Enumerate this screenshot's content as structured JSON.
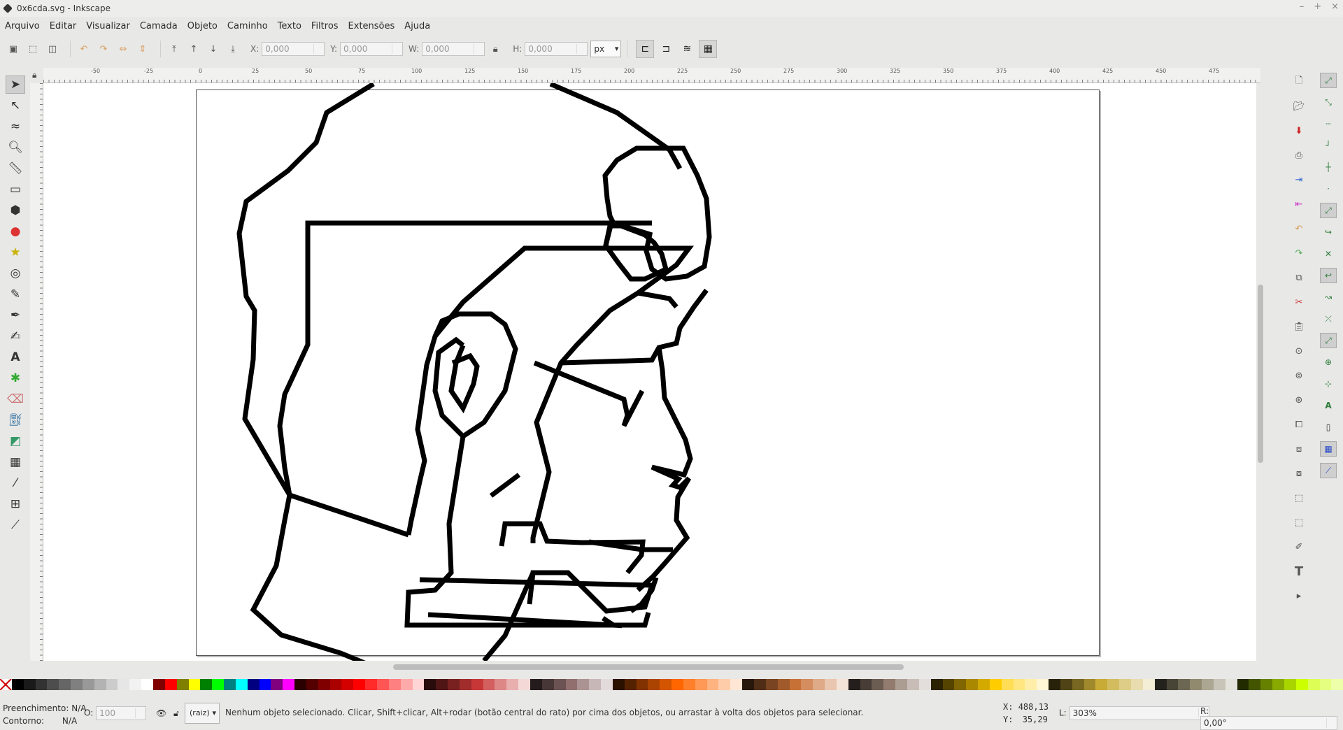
{
  "window": {
    "title": "0x6cda.svg - Inkscape",
    "controls": [
      "–",
      "+",
      "×"
    ]
  },
  "menu": [
    "Arquivo",
    "Editar",
    "Visualizar",
    "Camada",
    "Objeto",
    "Caminho",
    "Texto",
    "Filtros",
    "Extensões",
    "Ajuda"
  ],
  "toolbar": {
    "x_label": "X:",
    "x_value": "0,000",
    "y_label": "Y:",
    "y_value": "0,000",
    "w_label": "W:",
    "w_value": "0,000",
    "h_label": "H:",
    "h_value": "0,000",
    "unit": "px"
  },
  "ruler_ticks": [
    "-50",
    "-25",
    "0",
    "25",
    "50",
    "75",
    "100",
    "125",
    "150",
    "175",
    "200",
    "225",
    "250",
    "275",
    "300",
    "325",
    "350",
    "375",
    "400",
    "425",
    "450",
    "475"
  ],
  "tools": [
    "selector-tool",
    "node-tool",
    "tweak-tool",
    "zoom-tool",
    "measure-tool",
    "rectangle-tool",
    "3d-box-tool",
    "ellipse-tool",
    "star-tool",
    "spiral-tool",
    "pencil-tool",
    "pen-tool",
    "calligraphy-tool",
    "text-tool",
    "spray-tool",
    "eraser-tool",
    "paint-bucket-tool",
    "gradient-tool",
    "mesh-tool",
    "dropper-tool",
    "connector-tool",
    "lpe-tool"
  ],
  "status": {
    "fill_label": "Preenchimento:",
    "fill_value": "N/A",
    "stroke_label": "Contorno:",
    "stroke_value": "N/A",
    "opacity_label": "O:",
    "opacity_value": "100",
    "layer": "(raiz)",
    "message": "Nenhum objeto selecionado. Clicar, Shift+clicar, Alt+rodar (botão central do rato) por cima dos objetos, ou arrastar à volta dos objetos para selecionar.",
    "x_label": "X:",
    "x_value": "488,13",
    "y_label": "Y:",
    "y_value": "35,29",
    "zoom_label": "L:",
    "zoom_value": "303%",
    "rotation_label": "R:",
    "rotation_value": "0,00°"
  },
  "palette": [
    "#000000",
    "#1a1a1a",
    "#333333",
    "#4d4d4d",
    "#666666",
    "#808080",
    "#999999",
    "#b3b3b3",
    "#cccccc",
    "#e6e6e6",
    "#f2f2f2",
    "#ffffff",
    "#800000",
    "#ff0000",
    "#808000",
    "#ffff00",
    "#008000",
    "#00ff00",
    "#008080",
    "#00ffff",
    "#000080",
    "#0000ff",
    "#800080",
    "#ff00ff",
    "#2b0000",
    "#550000",
    "#800000",
    "#aa0000",
    "#d40000",
    "#ff0000",
    "#ff2a2a",
    "#ff5555",
    "#ff8080",
    "#ffaaaa",
    "#ffd5d5",
    "#280b0b",
    "#501616",
    "#782121",
    "#a02c2c",
    "#c83737",
    "#d35f5f",
    "#de8787",
    "#e9afaf",
    "#f4d7d7",
    "#241c1c",
    "#483737",
    "#6c5353",
    "#916f6f",
    "#ac9393",
    "#c8b7b7",
    "#e3dbdb",
    "#2b1100",
    "#552200",
    "#803300",
    "#aa4400",
    "#d45500",
    "#ff6600",
    "#ff7f2a",
    "#ff9955",
    "#ffb380",
    "#ffccaa",
    "#ffe6d5",
    "#28170b",
    "#502d16",
    "#784421",
    "#a05a2c",
    "#c87137",
    "#d38d5f",
    "#deaa87",
    "#e9c6af",
    "#f4e3d7",
    "#241f1c",
    "#483e37",
    "#6c5d53",
    "#917c6f",
    "#ac9d93",
    "#c8beb7",
    "#e3dedb",
    "#2b2200",
    "#554400",
    "#806600",
    "#aa8800",
    "#d4aa00",
    "#ffcc00",
    "#ffdd55",
    "#ffe680",
    "#ffeeaa",
    "#fff6d5",
    "#28220b",
    "#504416",
    "#786721",
    "#a0892c",
    "#c8ab37",
    "#d3bc5f",
    "#decd87",
    "#e9ddaf",
    "#f4eed7",
    "#24221c",
    "#484537",
    "#6c6753",
    "#918a6f",
    "#aca793",
    "#c8c4b7",
    "#e3e2db",
    "#222b00",
    "#445500",
    "#668000",
    "#88aa00",
    "#aad400",
    "#ccff00",
    "#ddff55",
    "#e5ff80",
    "#eeffaa"
  ]
}
